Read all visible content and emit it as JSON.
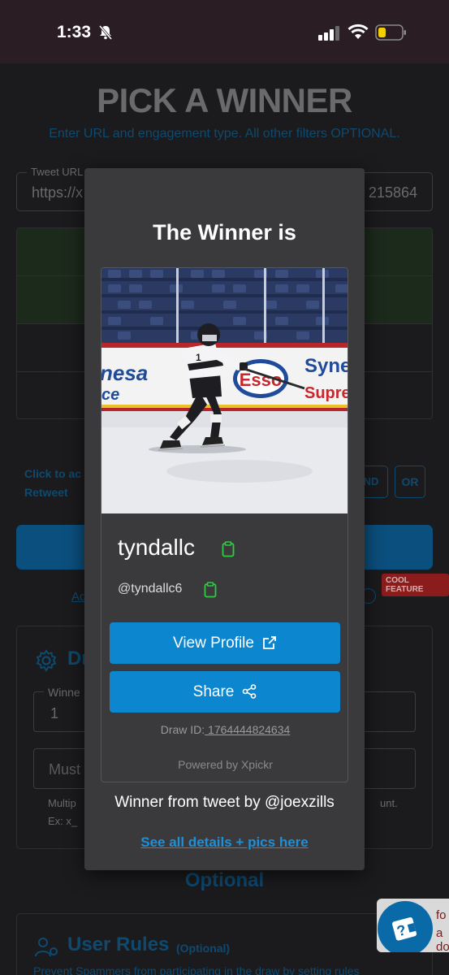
{
  "status_bar": {
    "time": "1:33"
  },
  "page": {
    "title": "PICK A WINNER",
    "subtitle": "Enter URL and engagement type. All other filters OPTIONAL.",
    "tweet_url_label": "Tweet URL",
    "tweet_url_start": "https://x",
    "tweet_url_end": "215864",
    "click_text_line1": "Click to ac",
    "click_text_line2": "Retweet",
    "and_label": "ND",
    "or_label": "OR",
    "cool_feature": "COOL FEATURE",
    "advanced_link": "Ad",
    "draw_title": "Dr",
    "winners_label": "Winne",
    "winners_value": "1",
    "must_placeholder": "Must",
    "helper_line1_start": "Multip",
    "helper_line1_end": "unt.",
    "helper_line2": "Ex: x_",
    "optional_heading": "Optional",
    "user_rules_title": "User Rules",
    "user_rules_optional": "(Optional)",
    "user_rules_desc": "Prevent Spammers from participating in the draw by setting rules",
    "help_text1": "fo",
    "help_text2": "a do"
  },
  "modal": {
    "title": "The Winner is",
    "winner_name": "tyndallc",
    "winner_handle": "@tyndallc6",
    "view_profile": "View Profile",
    "share": "Share",
    "draw_id_label": "Draw ID:",
    "draw_id_value": " 1764444824634",
    "powered_by": "Powered by Xpickr",
    "tweet_by": "Winner from tweet by @joexzills",
    "details_link": "See all details + pics here"
  },
  "photo_signage": {
    "left_sign_line1": "nesa",
    "left_sign_line2": "ce",
    "esso": "Esso",
    "right_sign_line1": "Syne",
    "right_sign_line2": "Supre"
  },
  "colors": {
    "modal_bg": "#3a3a3c",
    "primary_button": "#0b86cf",
    "link": "#1e8fd8",
    "copy_icon": "#2ecc40",
    "dim_accent": "#0e4a70"
  }
}
